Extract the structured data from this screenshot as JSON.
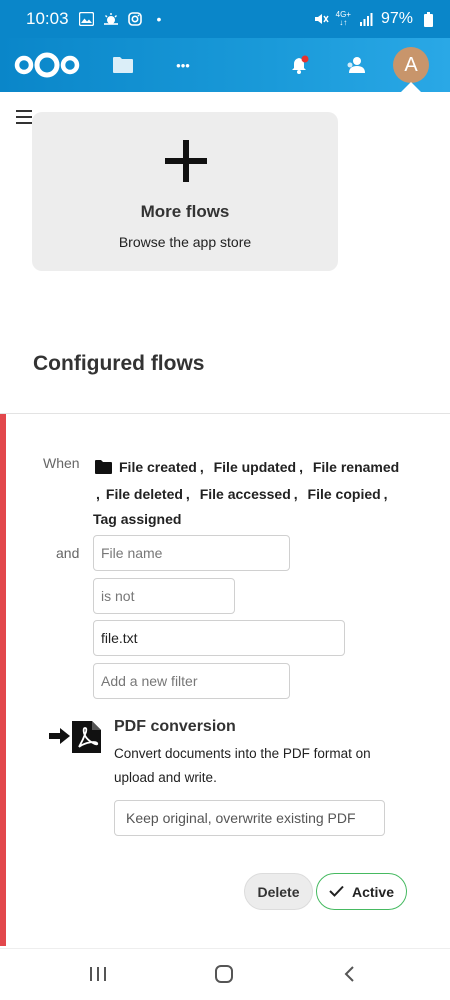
{
  "status_bar": {
    "time": "10:03",
    "network": "4G+",
    "battery": "97%",
    "dot": "•"
  },
  "header": {
    "avatar_letter": "A",
    "more_icon": "•••"
  },
  "more_flows": {
    "title": "More flows",
    "subtitle": "Browse the app store"
  },
  "configured_flows": {
    "title": "Configured flows"
  },
  "flow": {
    "when_label": "When",
    "and_label": "and",
    "events": [
      "File created",
      "File updated",
      "File renamed",
      "File deleted",
      "File accessed",
      "File copied",
      "Tag assigned"
    ],
    "separator": ",",
    "filter": {
      "field": "File name",
      "operator": "is not",
      "value": "file.txt",
      "add_placeholder": "Add a new filter"
    },
    "operation": {
      "title": "PDF conversion",
      "description": "Convert documents into the PDF format on upload and write.",
      "mode": "Keep original, overwrite existing PDF"
    },
    "delete_label": "Delete",
    "active_label": "Active"
  },
  "colors": {
    "brand": "#0a86c9",
    "rule_accent": "#e2474c",
    "active_border": "#46ba61",
    "notification_dot": "#e9322d"
  }
}
